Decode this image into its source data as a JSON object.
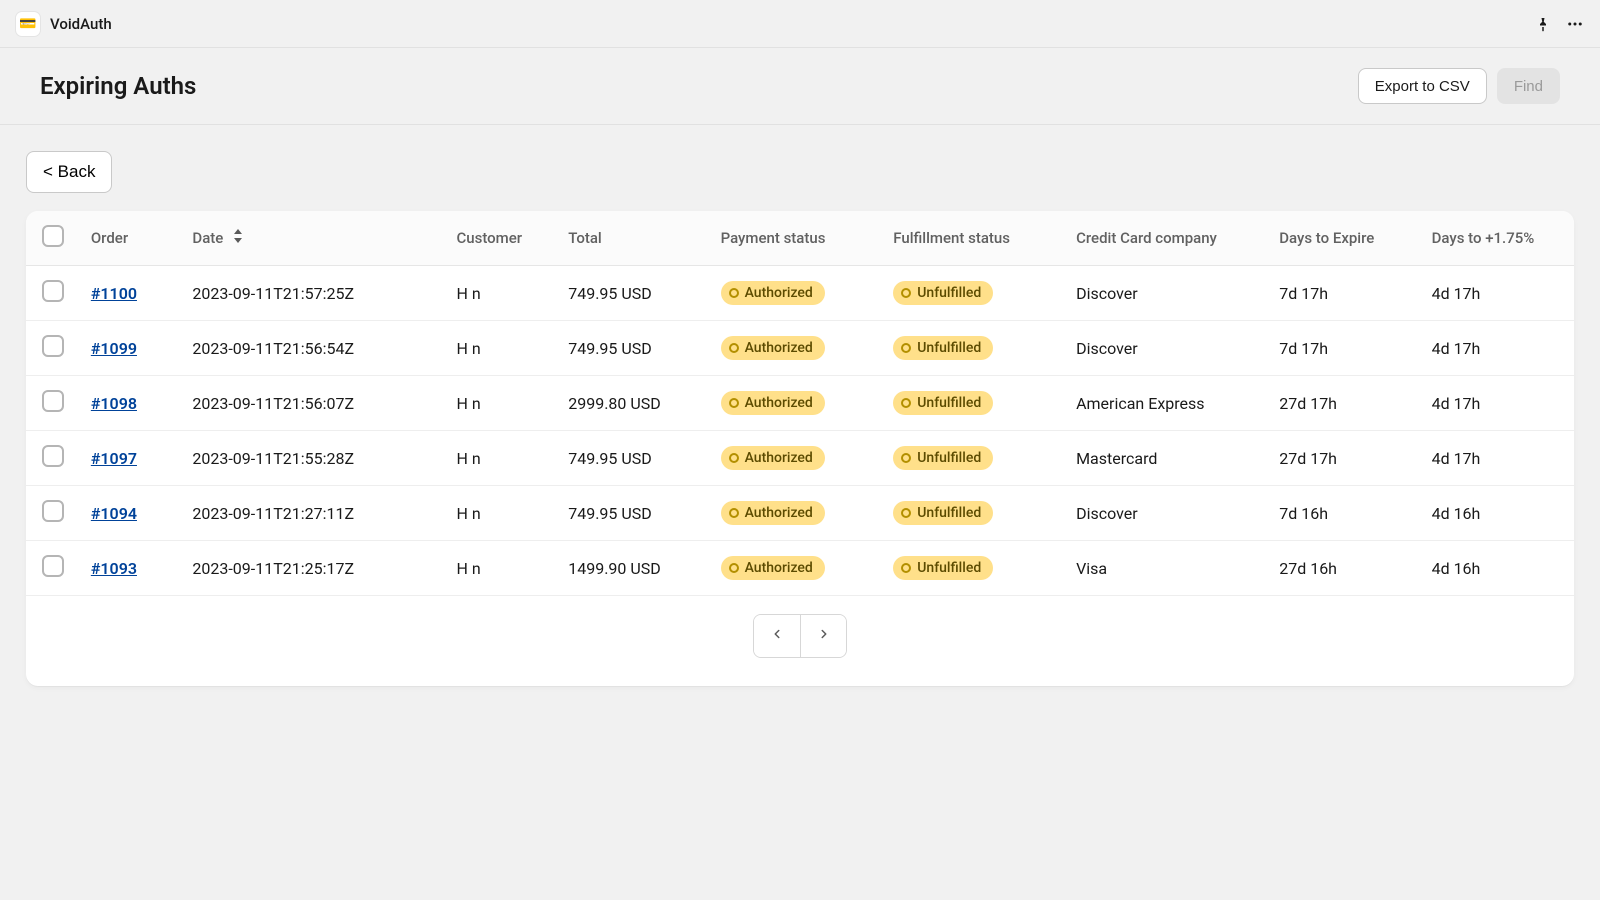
{
  "app": {
    "name": "VoidAuth",
    "icon_emoji": "💳"
  },
  "header": {
    "title": "Expiring Auths",
    "export_label": "Export to CSV",
    "find_label": "Find"
  },
  "back_label": "< Back",
  "columns": {
    "order": "Order",
    "date": "Date",
    "customer": "Customer",
    "total": "Total",
    "payment_status": "Payment status",
    "fulfillment_status": "Fulfillment status",
    "cc_company": "Credit Card company",
    "days_expire": "Days to Expire",
    "days_bonus": "Days to +1.75%"
  },
  "rows": [
    {
      "order": "#1100",
      "date": "2023-09-11T21:57:25Z",
      "customer": "H n",
      "total": "749.95 USD",
      "payment_status": "Authorized",
      "fulfillment_status": "Unfulfilled",
      "cc_company": "Discover",
      "days_expire": "7d 17h",
      "days_bonus": "4d 17h"
    },
    {
      "order": "#1099",
      "date": "2023-09-11T21:56:54Z",
      "customer": "H n",
      "total": "749.95 USD",
      "payment_status": "Authorized",
      "fulfillment_status": "Unfulfilled",
      "cc_company": "Discover",
      "days_expire": "7d 17h",
      "days_bonus": "4d 17h"
    },
    {
      "order": "#1098",
      "date": "2023-09-11T21:56:07Z",
      "customer": "H n",
      "total": "2999.80 USD",
      "payment_status": "Authorized",
      "fulfillment_status": "Unfulfilled",
      "cc_company": "American Express",
      "days_expire": "27d 17h",
      "days_bonus": "4d 17h"
    },
    {
      "order": "#1097",
      "date": "2023-09-11T21:55:28Z",
      "customer": "H n",
      "total": "749.95 USD",
      "payment_status": "Authorized",
      "fulfillment_status": "Unfulfilled",
      "cc_company": "Mastercard",
      "days_expire": "27d 17h",
      "days_bonus": "4d 17h"
    },
    {
      "order": "#1094",
      "date": "2023-09-11T21:27:11Z",
      "customer": "H n",
      "total": "749.95 USD",
      "payment_status": "Authorized",
      "fulfillment_status": "Unfulfilled",
      "cc_company": "Discover",
      "days_expire": "7d 16h",
      "days_bonus": "4d 16h"
    },
    {
      "order": "#1093",
      "date": "2023-09-11T21:25:17Z",
      "customer": "H n",
      "total": "1499.90 USD",
      "payment_status": "Authorized",
      "fulfillment_status": "Unfulfilled",
      "cc_company": "Visa",
      "days_expire": "27d 16h",
      "days_bonus": "4d 16h"
    }
  ]
}
